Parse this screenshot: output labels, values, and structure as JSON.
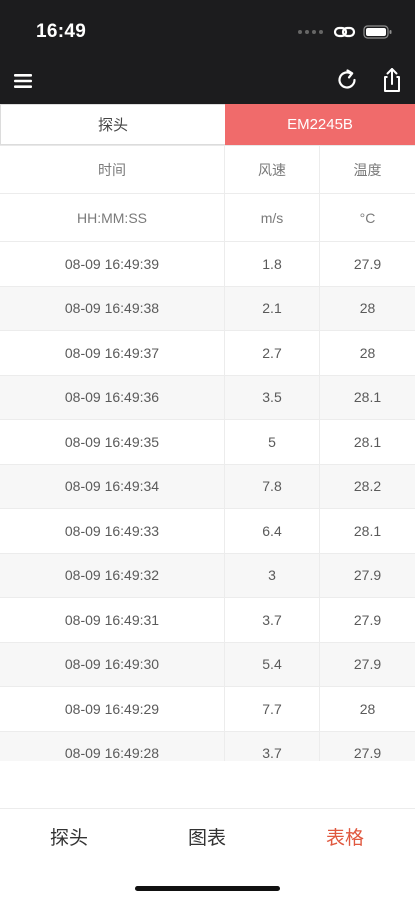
{
  "status": {
    "time": "16:49"
  },
  "segments": {
    "probe": "探头",
    "device": "EM2245B"
  },
  "table": {
    "headers": [
      "时间",
      "风速",
      "温度"
    ],
    "units": [
      "HH:MM:SS",
      "m/s",
      "°C"
    ],
    "rows": [
      [
        "08-09 16:49:39",
        "1.8",
        "27.9"
      ],
      [
        "08-09 16:49:38",
        "2.1",
        "28"
      ],
      [
        "08-09 16:49:37",
        "2.7",
        "28"
      ],
      [
        "08-09 16:49:36",
        "3.5",
        "28.1"
      ],
      [
        "08-09 16:49:35",
        "5",
        "28.1"
      ],
      [
        "08-09 16:49:34",
        "7.8",
        "28.2"
      ],
      [
        "08-09 16:49:33",
        "6.4",
        "28.1"
      ],
      [
        "08-09 16:49:32",
        "3",
        "27.9"
      ],
      [
        "08-09 16:49:31",
        "3.7",
        "27.9"
      ],
      [
        "08-09 16:49:30",
        "5.4",
        "27.9"
      ],
      [
        "08-09 16:49:29",
        "7.7",
        "28"
      ],
      [
        "08-09 16:49:28",
        "3.7",
        "27.9"
      ]
    ]
  },
  "tabbar": {
    "probe": "探头",
    "chart": "图表",
    "table": "表格"
  },
  "colors": {
    "accent": "#f06b6b",
    "active_tab": "#e0583f",
    "bar": "#1c1c1e"
  },
  "icons": [
    "signal-icon",
    "link-icon",
    "battery-icon",
    "menu-icon",
    "refresh-icon",
    "share-icon"
  ]
}
